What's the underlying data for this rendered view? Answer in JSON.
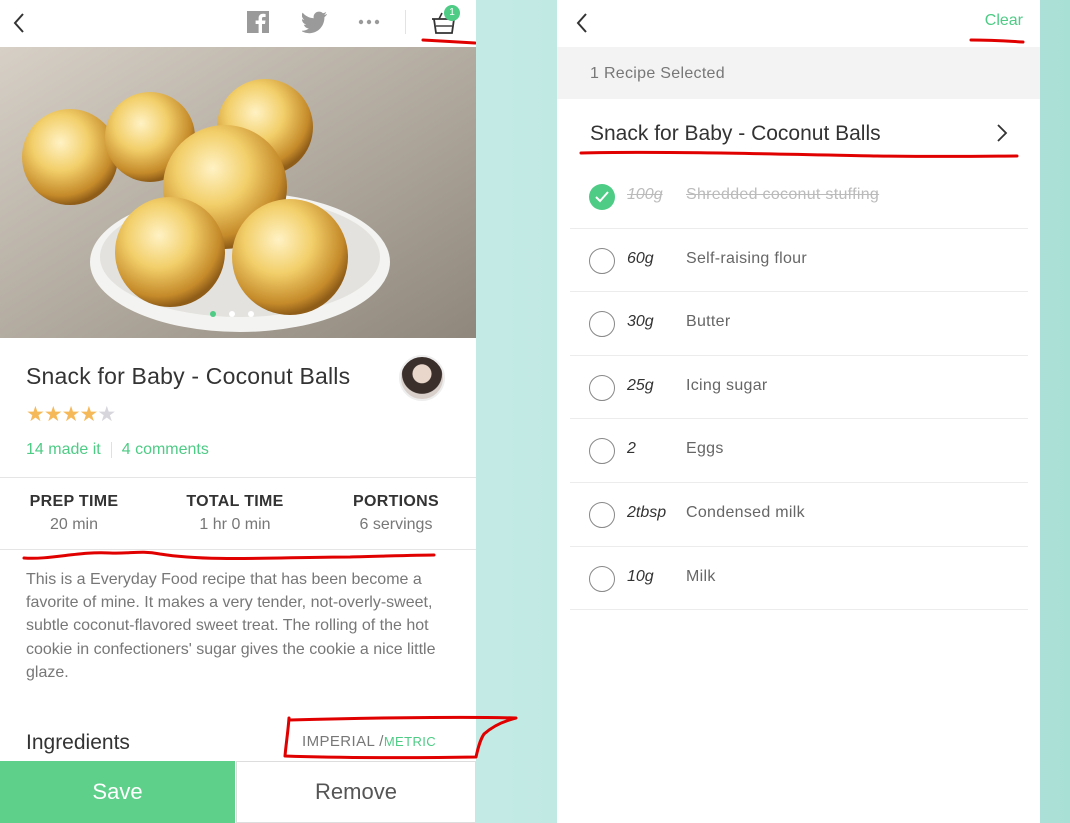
{
  "left": {
    "cart_badge": "1",
    "recipe_title": "Snack for Baby - Coconut Balls",
    "rating": {
      "value": 4,
      "max": 5
    },
    "made_it": "14 made it",
    "comments": "4 comments",
    "stats": [
      {
        "label": "PREP TIME",
        "value": "20 min"
      },
      {
        "label": "TOTAL TIME",
        "value": "1 hr  0 min"
      },
      {
        "label": "PORTIONS",
        "value": "6 servings"
      }
    ],
    "description": "This is a Everyday Food recipe that has been become a favorite of mine. It makes a very tender, not-overly-sweet, subtle coconut-flavored sweet treat. The rolling of the hot cookie in confectioners' sugar gives the cookie a nice little glaze.",
    "ingredients_title": "Ingredients",
    "units_imperial": "IMPERIAL /",
    "units_metric": "METRIC",
    "save_label": "Save",
    "remove_label": "Remove",
    "accent_color": "#4ecb85"
  },
  "right": {
    "clear_label": "Clear",
    "selected_text": "1 Recipe Selected",
    "recipe_name": "Snack for Baby - Coconut Balls",
    "ingredients": [
      {
        "qty": "100g",
        "name": "Shredded coconut stuffing",
        "checked": true
      },
      {
        "qty": "60g",
        "name": "Self-raising flour",
        "checked": false
      },
      {
        "qty": "30g",
        "name": "Butter",
        "checked": false
      },
      {
        "qty": "25g",
        "name": "Icing sugar",
        "checked": false
      },
      {
        "qty": "2",
        "name": "Eggs",
        "checked": false
      },
      {
        "qty": "2tbsp",
        "name": "Condensed milk",
        "checked": false
      },
      {
        "qty": "10g",
        "name": "Milk",
        "checked": false
      }
    ]
  }
}
